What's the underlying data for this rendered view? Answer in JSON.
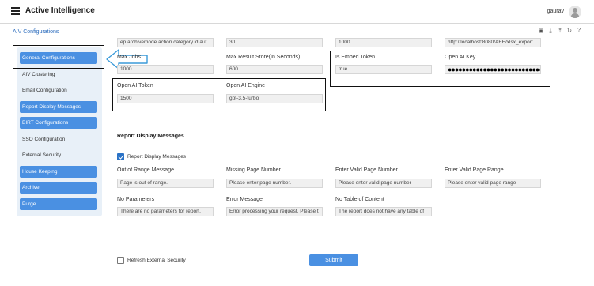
{
  "app": {
    "title": "Active Intelligence",
    "user": "gaurav"
  },
  "breadcrumb": "AIV Configurations",
  "toolbar": {
    "help": "?"
  },
  "sidebar": {
    "items": [
      {
        "label": "General Configurations",
        "style": "button"
      },
      {
        "label": "AIV Clustering",
        "style": "plain"
      },
      {
        "label": "Email Configuration",
        "style": "plain"
      },
      {
        "label": "Report Display Messages",
        "style": "button"
      },
      {
        "label": "BIRT Configurations",
        "style": "button"
      },
      {
        "label": "SSO Configuration",
        "style": "plain"
      },
      {
        "label": "External Security",
        "style": "plain"
      },
      {
        "label": "House Keeping",
        "style": "button"
      },
      {
        "label": "Archive",
        "style": "button"
      },
      {
        "label": "Purge",
        "style": "button"
      }
    ]
  },
  "general": {
    "row0": [
      "ep.archivemode.action.category.id,aut",
      "30",
      "1000",
      "http://localhost:8080/AEE/xlsx_export"
    ],
    "max_jobs": {
      "label": "Max Jobs",
      "value": "1000"
    },
    "max_result_store": {
      "label": "Max Result Store(In Seconds)",
      "value": "600"
    },
    "is_embed_token": {
      "label": "Is Embed Token",
      "value": "true"
    },
    "open_ai_key": {
      "label": "Open AI Key",
      "value": "●●●●●●●●●●●●●●●●●●●●●●●●●●●●●●●●●●●●●●●●●●●"
    },
    "open_ai_token": {
      "label": "Open AI Token",
      "value": "1500"
    },
    "open_ai_engine": {
      "label": "Open AI Engine",
      "value": "gpt-3.5-turbo"
    }
  },
  "report_messages": {
    "title": "Report Display Messages",
    "checkbox_label": "Report Display Messages",
    "fields": [
      {
        "label": "Out of Range Message",
        "value": "Page is out of range."
      },
      {
        "label": "Missing Page Number",
        "value": "Please enter page number."
      },
      {
        "label": "Enter Valid Page Number",
        "value": "Please enter valid page number"
      },
      {
        "label": "Enter Valid Page Range",
        "value": "Please enter valid page range"
      },
      {
        "label": "No Parameters",
        "value": "There are no parameters for report."
      },
      {
        "label": "Error Message",
        "value": "Error processing your request, Please t"
      },
      {
        "label": "No Table of Content",
        "value": "The report does not have any table of"
      }
    ]
  },
  "footer": {
    "refresh_label": "Refresh External Security",
    "submit_label": "Submit"
  },
  "colors": {
    "accent": "#4a90e2",
    "sidebar_bg": "#e8f0f8",
    "link": "#2a6bbd",
    "arrow": "#3a9ad9"
  }
}
